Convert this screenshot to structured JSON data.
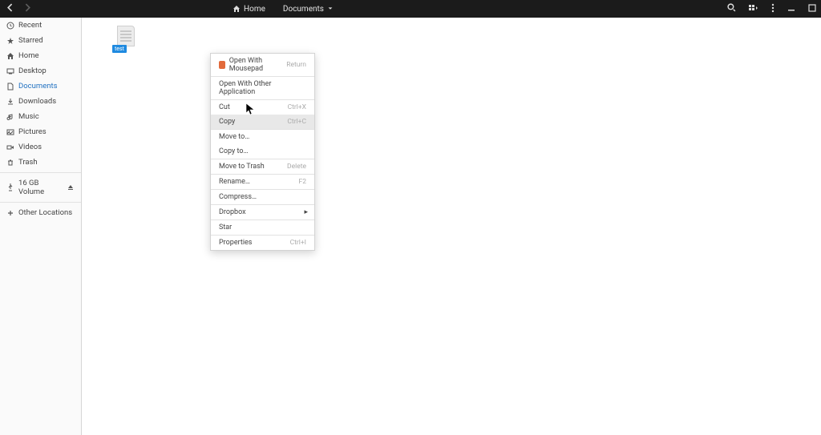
{
  "header": {
    "breadcrumb_home": "Home",
    "breadcrumb_current": "Documents"
  },
  "sidebar": {
    "items": [
      {
        "icon": "clock",
        "label": "Recent"
      },
      {
        "icon": "star",
        "label": "Starred"
      },
      {
        "icon": "home",
        "label": "Home"
      },
      {
        "icon": "desktop",
        "label": "Desktop"
      },
      {
        "icon": "doc",
        "label": "Documents",
        "active": true
      },
      {
        "icon": "download",
        "label": "Downloads"
      },
      {
        "icon": "music",
        "label": "Music"
      },
      {
        "icon": "picture",
        "label": "Pictures"
      },
      {
        "icon": "video",
        "label": "Videos"
      },
      {
        "icon": "trash",
        "label": "Trash"
      }
    ],
    "volume_label": "16 GB Volume",
    "other_label": "Other Locations"
  },
  "file": {
    "label": "test"
  },
  "context_menu": {
    "open_with_app": "Open With Mousepad",
    "open_with_app_accel": "Return",
    "open_other": "Open With Other Application",
    "cut": "Cut",
    "cut_accel": "Ctrl+X",
    "copy": "Copy",
    "copy_accel": "Ctrl+C",
    "move_to": "Move to…",
    "copy_to": "Copy to…",
    "move_trash": "Move to Trash",
    "move_trash_accel": "Delete",
    "rename": "Rename…",
    "rename_accel": "F2",
    "compress": "Compress…",
    "dropbox": "Dropbox",
    "star": "Star",
    "properties": "Properties",
    "properties_accel": "Ctrl+I"
  }
}
